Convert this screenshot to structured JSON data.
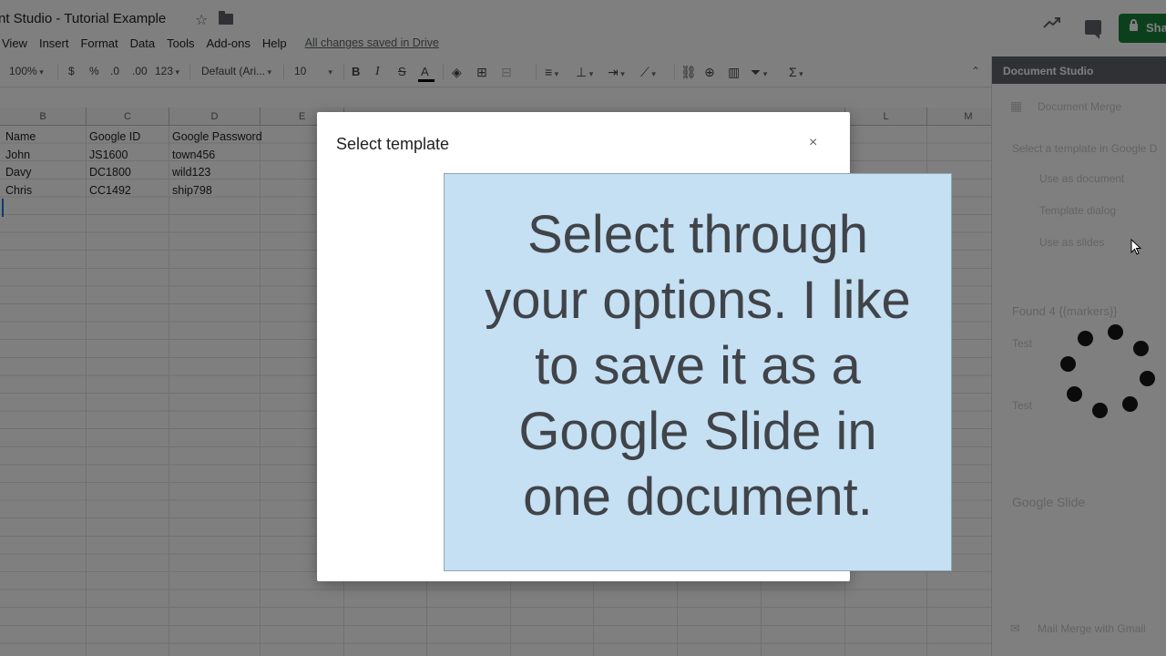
{
  "titlebar": {
    "doc_title": "nt Studio - Tutorial Example",
    "share_label": "Sha"
  },
  "menu": {
    "items": [
      "View",
      "Insert",
      "Format",
      "Data",
      "Tools",
      "Add-ons",
      "Help"
    ],
    "saved_status": "All changes saved in Drive"
  },
  "toolbar": {
    "zoom": "100%",
    "currency": "$",
    "percent": "%",
    "decrease_decimals": ".0",
    "increase_decimals": ".00",
    "more_formats": "123",
    "font": "Default (Ari...",
    "font_size": "10",
    "bold": "B",
    "italic": "I",
    "strikethrough": "S",
    "text_color": "A",
    "functions": "Σ"
  },
  "sheet": {
    "columns": [
      "B",
      "C",
      "D",
      "E",
      "L",
      "M"
    ],
    "rows": [
      [
        "Name",
        "Google ID",
        "Google Password"
      ],
      [
        "John",
        "JS1600",
        "town456"
      ],
      [
        "Davy",
        "DC1800",
        "wild123"
      ],
      [
        "Chris",
        "CC1492",
        "ship798"
      ]
    ]
  },
  "side_panel": {
    "title": "Document Studio",
    "faint_items": [
      "Document Merge",
      "Select a template in Google D",
      "Use as document",
      "Template dialog",
      "Use as slides",
      "Found 4 {{markers}}",
      "Test",
      "Test",
      "Google Slide",
      "Mail Merge with Gmail"
    ]
  },
  "modal": {
    "title": "Select template",
    "close_symbol": "×"
  },
  "caption": {
    "text": "Select through your options. I like to save it as a Google Slide in one document."
  },
  "colors": {
    "share_green": "#188038",
    "panel_header": "#5f6368",
    "caption_bg": "#c5dff3",
    "selection_blue": "#1a73e8"
  }
}
